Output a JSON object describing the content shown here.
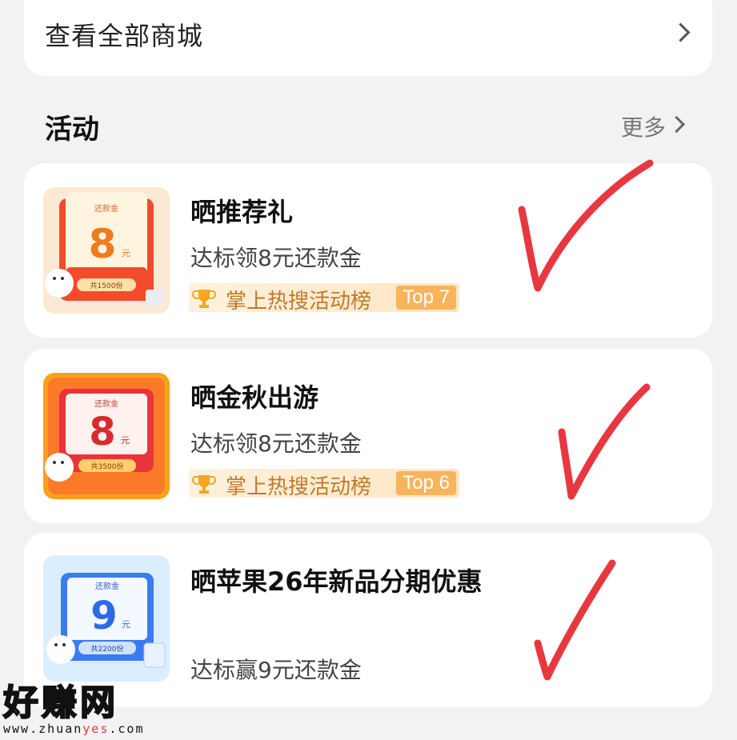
{
  "store": {
    "label": "查看全部商城"
  },
  "section": {
    "title": "活动",
    "more_label": "更多"
  },
  "activities": [
    {
      "title": "晒推荐礼",
      "desc": "达标领8元还款金",
      "rank_text": "掌上热搜活动榜",
      "rank_badge": "Top 7",
      "thumb": {
        "label": "还款金",
        "amount": "8",
        "unit": "元",
        "quota": "共1500份"
      }
    },
    {
      "title": "晒金秋出游",
      "desc": "达标领8元还款金",
      "rank_text": "掌上热搜活动榜",
      "rank_badge": "Top 6",
      "thumb": {
        "label": "还款金",
        "amount": "8",
        "unit": "元",
        "quota": "共3500份"
      }
    },
    {
      "title": "晒苹果26年新品分期优惠",
      "desc": "达标赢9元还款金",
      "thumb": {
        "label": "还款金",
        "amount": "9",
        "unit": "元",
        "quota": "共2200份"
      }
    }
  ],
  "watermark": {
    "title": "好赚网",
    "url_a": "www.zhuan",
    "url_b": "yes",
    "url_c": ".com"
  },
  "colors": {
    "accent": "#f7b45c",
    "check_mark": "#e8383f",
    "rank_text": "#c07a2a"
  }
}
